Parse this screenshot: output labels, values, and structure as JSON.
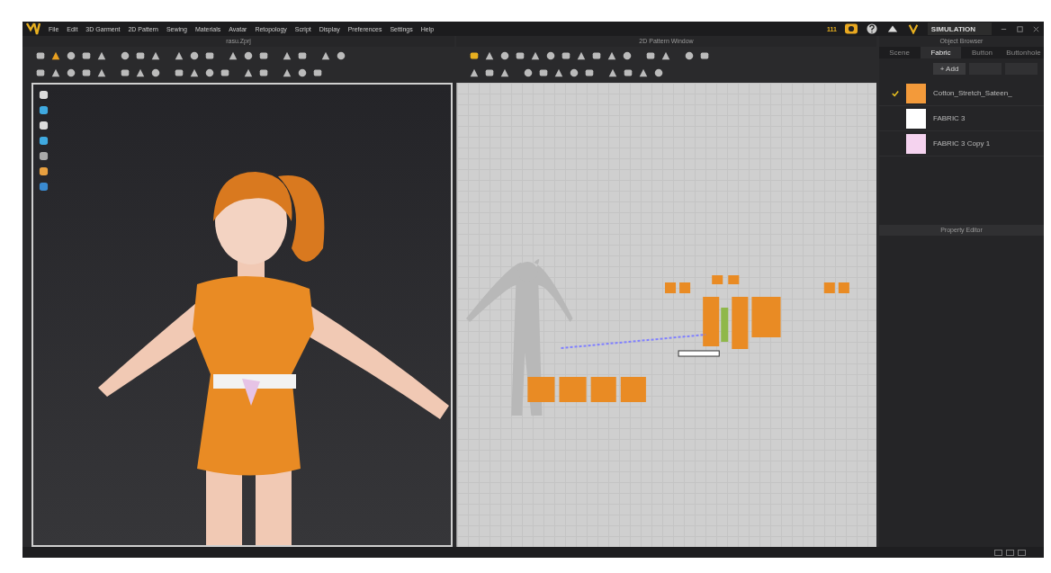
{
  "menu": [
    "File",
    "Edit",
    "3D Garment",
    "2D Pattern",
    "Sewing",
    "Materials",
    "Avatar",
    "Retopology",
    "Script",
    "Display",
    "Preferences",
    "Settings",
    "Help"
  ],
  "status": {
    "counter": "111",
    "mode": "SIMULATION"
  },
  "viewport_3d": {
    "title": "rasu.Zprj"
  },
  "pattern_window": {
    "title": "2D Pattern Window"
  },
  "object_browser": {
    "title": "Object Browser",
    "tabs": [
      {
        "label": "Scene",
        "selected": false
      },
      {
        "label": "Fabric",
        "selected": true
      },
      {
        "label": "Button",
        "selected": false
      },
      {
        "label": "Buttonhole",
        "selected": false
      }
    ],
    "add_button": "+ Add",
    "fabrics": [
      {
        "name": "Cotton_Stretch_Sateen_",
        "color": "#f39a3a",
        "checked": true
      },
      {
        "name": "FABRIC 3",
        "color": "#ffffff",
        "checked": false
      },
      {
        "name": "FABRIC 3 Copy 1",
        "color": "#f5d3ef",
        "checked": false
      }
    ]
  },
  "property_editor": {
    "title": "Property Editor"
  }
}
